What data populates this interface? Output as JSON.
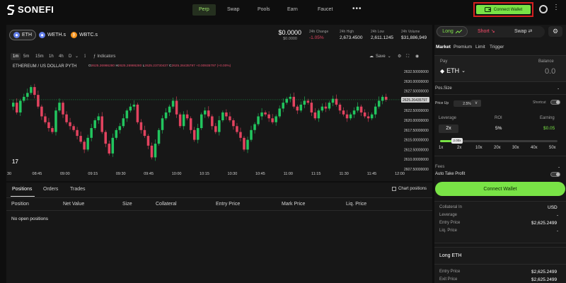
{
  "app": {
    "name": "SONEFI"
  },
  "nav": {
    "tabs": [
      {
        "label": "Perp",
        "active": true
      },
      {
        "label": "Swap"
      },
      {
        "label": "Pools"
      },
      {
        "label": "Earn"
      },
      {
        "label": "Faucet"
      }
    ],
    "more": "•••",
    "connect_wallet": "Connect Wallet"
  },
  "assets": [
    {
      "symbol": "ETH",
      "active": true,
      "icon": "eth-icon",
      "color": "#627eea"
    },
    {
      "symbol": "WETH.s",
      "icon": "weth-icon",
      "color": "#627eea"
    },
    {
      "symbol": "WBTC.s",
      "icon": "wbtc-icon",
      "color": "#f7931a"
    }
  ],
  "market_stats": {
    "price": "$0.0000",
    "price_sub": "$0.0000",
    "change_label": "24h Change",
    "change_value": "-1.05%",
    "high_label": "24h High",
    "high_value": "2,673.4500",
    "low_label": "24h Low",
    "low_value": "2,611.1245",
    "volume_label": "24h Volume",
    "volume_value": "$31,886,949"
  },
  "chart_toolbar": {
    "intervals": [
      "1m",
      "5m",
      "15m",
      "1h",
      "4h",
      "D"
    ],
    "active_interval": "1m",
    "indicators_label": "Indicators",
    "save_label": "Save"
  },
  "chart_header": {
    "title": "ETHEREUM / US DOLLAR   PYTH",
    "ohlc_o_key": "O",
    "ohlc_o": "2625.26986280",
    "ohlc_h_key": "H",
    "ohlc_h": "2625.26986280",
    "ohlc_l_key": "L",
    "ohlc_l": "2625.23730437",
    "ohlc_c_key": "C",
    "ohlc_c": "2625.26435797",
    "ohlc_change": "+0.00935797 (+0.00%)"
  },
  "chart_data": {
    "type": "candlestick",
    "x_ticks": [
      "30",
      "08:45",
      "09:00",
      "09:15",
      "09:30",
      "09:45",
      "10:00",
      "10:15",
      "10:30",
      "10:45",
      "11:00",
      "11:15",
      "11:30",
      "11:45",
      "12:00"
    ],
    "y_ticks": [
      "2632.50000000",
      "2630.00000000",
      "2627.50000000",
      "2625.00000000",
      "2622.50000000",
      "2620.00000000",
      "2617.50000000",
      "2615.00000000",
      "2612.50000000",
      "2610.00000000",
      "2607.50000000"
    ],
    "ylim": [
      2607.5,
      2632.5
    ],
    "current_price_label": "2625.26435797",
    "current_price": 2625.264,
    "up_color": "#22c55e",
    "down_color": "#e2435f",
    "close_path": [
      2623.5,
      2624.5,
      2622.0,
      2625.0,
      2626.0,
      2627.0,
      2628.5,
      2626.5,
      2623.5,
      2621.0,
      2619.5,
      2618.0,
      2617.0,
      2622.5,
      2624.5,
      2621.5,
      2619.5,
      2618.5,
      2617.5,
      2616.0,
      2614.5,
      2612.5,
      2615.5,
      2618.0,
      2620.0,
      2621.0,
      2617.0,
      2614.0,
      2611.5,
      2615.5,
      2617.5,
      2618.5,
      2620.5,
      2622.5,
      2623.5,
      2624.0,
      2619.5,
      2617.5,
      2616.0,
      2613.5,
      2610.5,
      2614.0,
      2617.5,
      2620.5,
      2622.0,
      2623.5,
      2625.0,
      2621.5,
      2618.5,
      2621.5,
      2620.5,
      2617.5,
      2615.0,
      2618.0,
      2621.5,
      2622.5,
      2621.0,
      2618.5,
      2617.0,
      2620.0,
      2622.0,
      2621.0,
      2620.0,
      2618.5,
      2617.0,
      2615.5,
      2612.5,
      2615.0,
      2617.5,
      2619.0,
      2621.0,
      2622.0,
      2621.5,
      2620.5,
      2619.5,
      2621.0,
      2623.0,
      2624.5,
      2625.5,
      2626.0,
      2623.5,
      2622.5,
      2624.0,
      2625.0,
      2624.5,
      2622.0,
      2620.5,
      2622.5,
      2623.5,
      2623.0,
      2624.5,
      2625.5,
      2624.0,
      2622.5,
      2621.5,
      2620.5,
      2621.5,
      2622.5,
      2623.5,
      2622.0,
      2621.0,
      2620.5,
      2621.5,
      2623.5,
      2625.0,
      2626.0,
      2625.26
    ]
  },
  "positions": {
    "tabs": [
      {
        "label": "Positions",
        "active": true
      },
      {
        "label": "Orders"
      },
      {
        "label": "Trades"
      }
    ],
    "chart_positions_label": "Chart positions",
    "columns": [
      "Position",
      "Net Value",
      "Size",
      "Collateral",
      "Entry Price",
      "Mark Price",
      "Liq. Price"
    ],
    "empty": "No open positions"
  },
  "side": {
    "modes": {
      "long": "Long",
      "short": "Short",
      "swap": "Swap"
    },
    "order_types": [
      "Market",
      "Premium",
      "Limit",
      "Trigger"
    ],
    "pay_label": "Pay",
    "balance_label": "Balance",
    "pay_token": "ETH",
    "pay_amount": "0.0",
    "pos_size_label": "Pos.Size",
    "pos_size_value": "-",
    "price_up_label": "Price Up",
    "price_up_value": "2.5%",
    "price_up_dd": "v",
    "shortcut_label": "Shortcut",
    "leverage_label": "Leverage",
    "roi_label": "ROI",
    "earning_label": "Earning",
    "leverage_value": "2x",
    "roi_value": "5%",
    "earning_value": "$0.05",
    "slider_value": 2,
    "slider_fraction": 0.04,
    "slider_knob_label": "2.00x",
    "slider_ticks": [
      "1x",
      "2x",
      "10x",
      "20x",
      "30x",
      "40x",
      "50x"
    ],
    "fees_label": "Fees",
    "fees_value": "-",
    "auto_tp_label": "Auto Take Profit",
    "connect_wallet": "Connect Wallet",
    "info": {
      "collateral_in_label": "Collateral In",
      "collateral_in_value": "USD",
      "leverage_label": "Leverage",
      "leverage_value": "-",
      "entry_label": "Entry Price",
      "entry_value": "$2,625.2499",
      "liq_label": "Liq. Price",
      "liq_value": "-"
    },
    "long_section": {
      "title": "Long ETH",
      "entry_label": "Entry Price",
      "entry_value": "$2,625.2499",
      "exit_label": "Exit Price",
      "exit_value": "$2,625.2499"
    },
    "accent_color": "#79e346"
  }
}
